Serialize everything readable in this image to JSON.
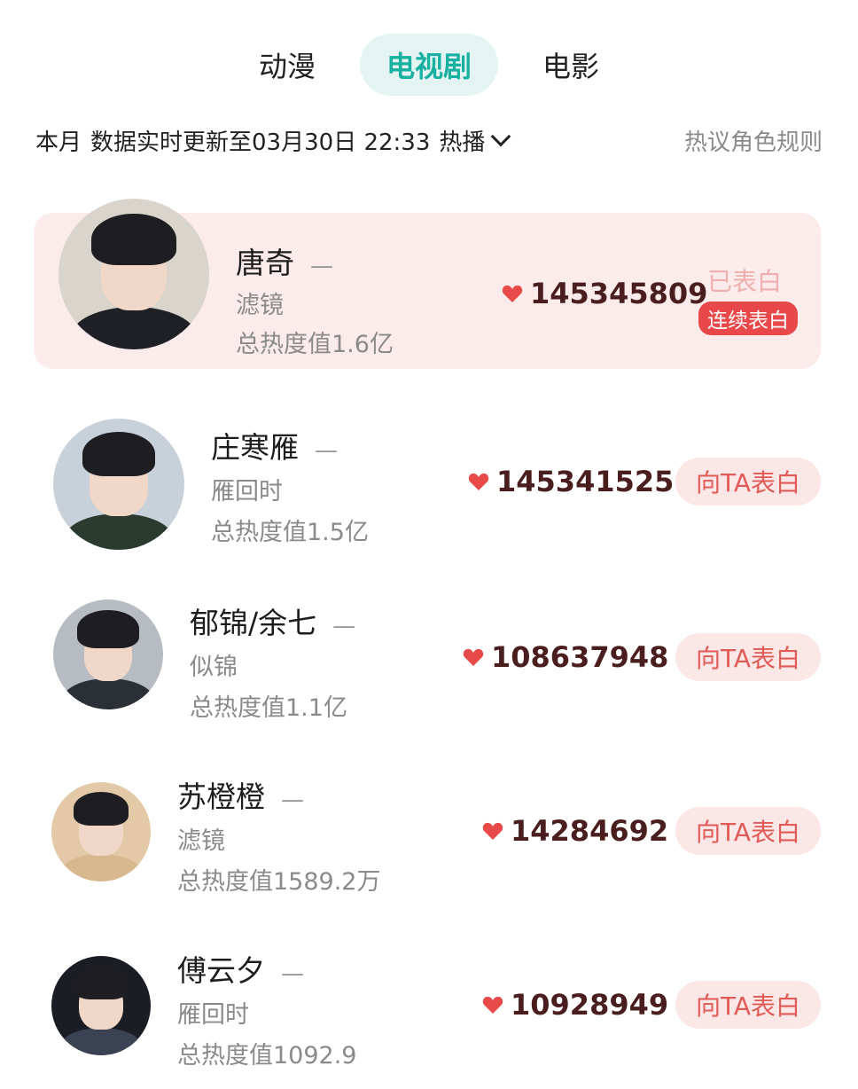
{
  "tabs": [
    "动漫",
    "电视剧",
    "电影"
  ],
  "active_tab": "电视剧",
  "info": {
    "period": "本月",
    "update_text": "数据实时更新至03月30日 22:33",
    "filter": "热播",
    "rules": "热议角色规则"
  },
  "rows": [
    {
      "name": "唐奇",
      "drama": "滤镜",
      "total": "总热度值1.6亿",
      "score": "145345809",
      "already": "已表白",
      "continue": "连续表白"
    },
    {
      "name": "庄寒雁",
      "drama": "雁回时",
      "total": "总热度值1.5亿",
      "score": "145341525",
      "button": "向TA表白"
    },
    {
      "name": "郁锦/余七",
      "drama": "似锦",
      "total": "总热度值1.1亿",
      "score": "108637948",
      "button": "向TA表白"
    },
    {
      "name": "苏橙橙",
      "drama": "滤镜",
      "total": "总热度值1589.2万",
      "score": "14284692",
      "button": "向TA表白"
    },
    {
      "name": "傅云夕",
      "drama": "雁回时",
      "total": "总热度值1092.9",
      "score": "10928949",
      "button": "向TA表白"
    }
  ],
  "rank_dash": "—",
  "colors": {
    "accent": "#18b0a0",
    "heart": "#e84a4a",
    "button_text": "#e25a57",
    "button_bg": "#fbe7e6",
    "top_row_bg": "#fcebeb"
  }
}
